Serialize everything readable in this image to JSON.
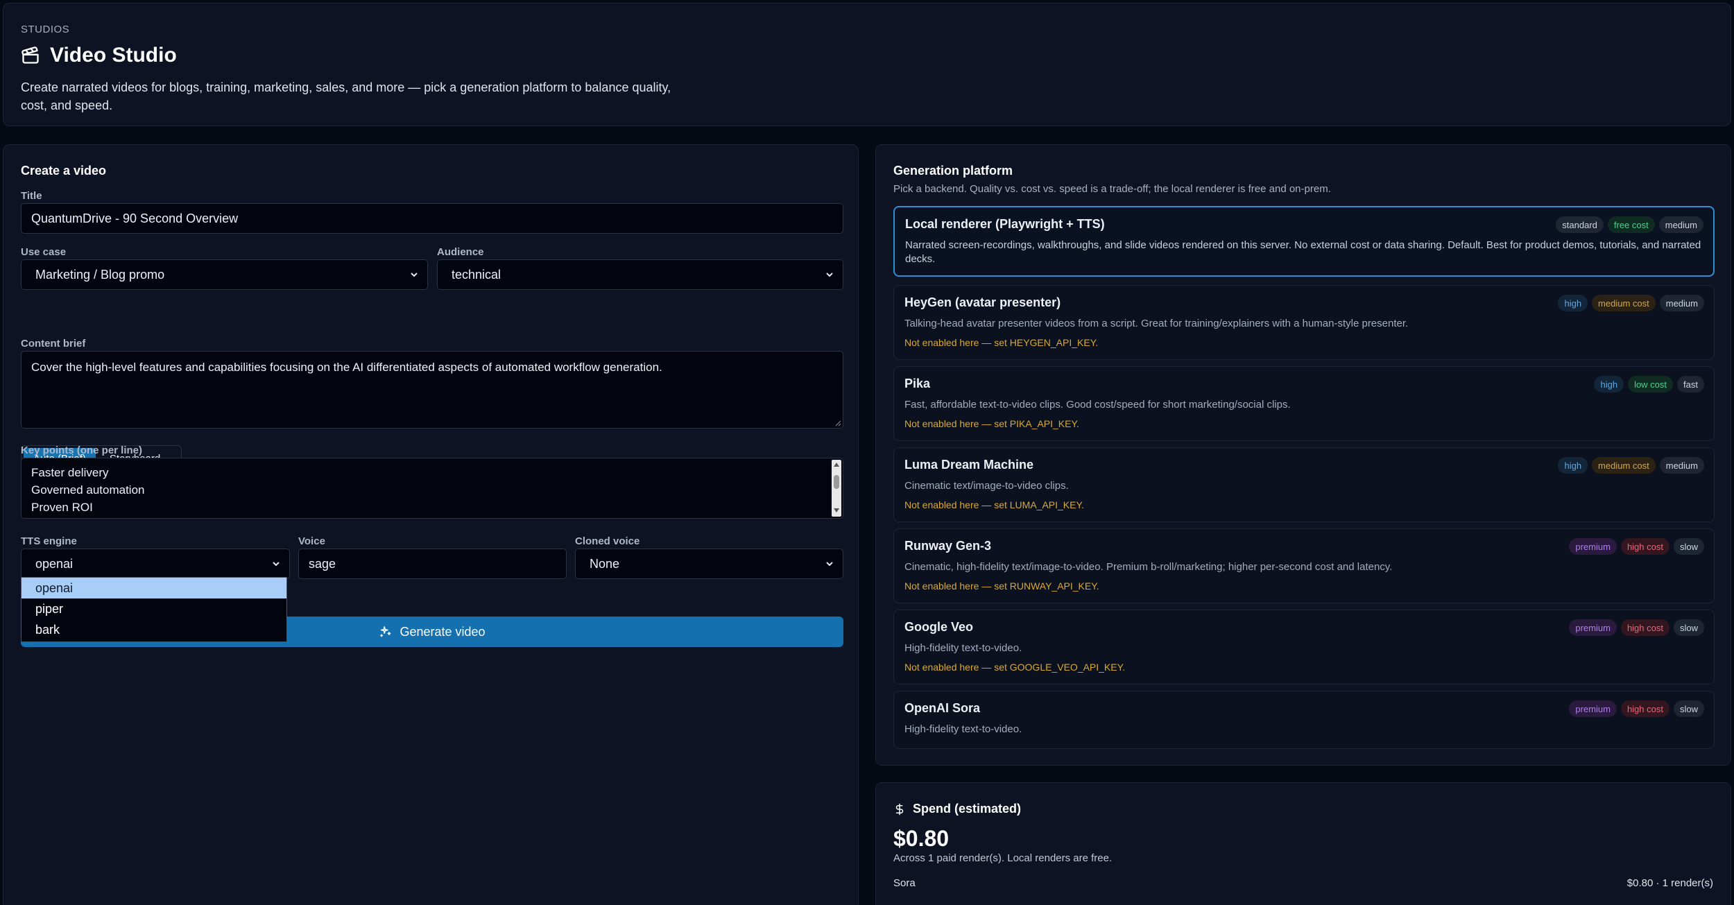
{
  "header": {
    "kicker": "STUDIOS",
    "title": "Video Studio",
    "description": "Create narrated videos for blogs, training, marketing, sales, and more — pick a generation platform to balance quality, cost, and speed."
  },
  "create": {
    "section_title": "Create a video",
    "title_label": "Title",
    "title_value": "QuantumDrive - 90 Second Overview",
    "use_case_label": "Use case",
    "use_case_value": "Marketing / Blog promo",
    "audience_label": "Audience",
    "audience_value": "technical",
    "mode_tabs": [
      {
        "label": "Auto (Brief)",
        "active": true
      },
      {
        "label": "Storyboard",
        "active": false
      }
    ],
    "brief_label": "Content brief",
    "brief_value": "Cover the high-level features and capabilities focusing on the AI differentiated aspects of automated workflow generation.",
    "key_points_label": "Key points (one per line)",
    "key_points": [
      "Faster delivery",
      "Governed automation",
      "Proven ROI"
    ],
    "tts_label": "TTS engine",
    "tts_value": "openai",
    "tts_options": [
      "openai",
      "piper",
      "bark"
    ],
    "voice_label": "Voice",
    "voice_value": "sage",
    "cloned_label": "Cloned voice",
    "cloned_value": "None",
    "generate_label": "Generate video"
  },
  "platform": {
    "section_title": "Generation platform",
    "subtitle": "Pick a backend. Quality vs. cost vs. speed is a trade-off; the local renderer is free and on-prem.",
    "cards": [
      {
        "name": "Local renderer (Playwright + TTS)",
        "desc": "Narrated screen-recordings, walkthroughs, and slide videos rendered on this server. No external cost or data sharing. Default. Best for product demos, tutorials, and narrated decks.",
        "warn": "",
        "badges": [
          "standard",
          "free cost",
          "medium"
        ]
      },
      {
        "name": "HeyGen (avatar presenter)",
        "desc": "Talking-head avatar presenter videos from a script. Great for training/explainers with a human-style presenter.",
        "warn": "Not enabled here — set HEYGEN_API_KEY.",
        "badges": [
          "high",
          "medium cost",
          "medium"
        ]
      },
      {
        "name": "Pika",
        "desc": "Fast, affordable text-to-video clips. Good cost/speed for short marketing/social clips.",
        "warn": "Not enabled here — set PIKA_API_KEY.",
        "badges": [
          "high",
          "low cost",
          "fast"
        ]
      },
      {
        "name": "Luma Dream Machine",
        "desc": "Cinematic text/image-to-video clips.",
        "warn": "Not enabled here — set LUMA_API_KEY.",
        "badges": [
          "high",
          "medium cost",
          "medium"
        ]
      },
      {
        "name": "Runway Gen-3",
        "desc": "Cinematic, high-fidelity text/image-to-video. Premium b-roll/marketing; higher per-second cost and latency.",
        "warn": "Not enabled here — set RUNWAY_API_KEY.",
        "badges": [
          "premium",
          "high cost",
          "slow"
        ]
      },
      {
        "name": "Google Veo",
        "desc": "High-fidelity text-to-video.",
        "warn": "Not enabled here — set GOOGLE_VEO_API_KEY.",
        "badges": [
          "premium",
          "high cost",
          "slow"
        ]
      },
      {
        "name": "OpenAI Sora",
        "desc": "High-fidelity text-to-video.",
        "warn": "",
        "badges": [
          "premium",
          "high cost",
          "slow"
        ]
      }
    ]
  },
  "spend": {
    "title": "Spend (estimated)",
    "amount": "$0.80",
    "note": "Across 1 paid render(s). Local renders are free.",
    "row_label": "Sora",
    "row_value": "$0.80 · 1 render(s)"
  },
  "colors": {
    "accent": "#1470ae",
    "active_border": "#2b8fd6",
    "warning": "#d9a933",
    "background": "#060a14",
    "panel": "#0d1322"
  }
}
